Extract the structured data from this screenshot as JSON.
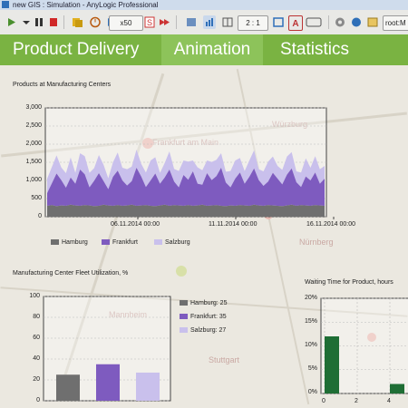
{
  "window": {
    "title": "new GIS : Simulation - AnyLogic Professional"
  },
  "toolbar": {
    "speed_label": "x50",
    "ratio_label": "2 : 1",
    "path_value": "root:M"
  },
  "tabs": [
    {
      "label": "Product Delivery",
      "active": false
    },
    {
      "label": "Animation",
      "active": true
    },
    {
      "label": "Statistics",
      "active": false
    }
  ],
  "map": {
    "places": [
      "Frankfurt am Main",
      "Würzburg",
      "Mannheim",
      "Nürnberg",
      "Stuttgart"
    ]
  },
  "colors": {
    "tab_bar": "#7ab342",
    "tab_active": "#8dc35a",
    "hamburg": "#6f6f6f",
    "frankfurt": "#7e5bbf",
    "salzburg": "#c9c0ec",
    "waiting": "#1f6e35"
  },
  "chart_data": [
    {
      "type": "area",
      "title": "Products at Manufacturing Centers",
      "y_ticks": [
        "3,000",
        "2,500",
        "2,000",
        "1,500",
        "1,000",
        "500",
        "0"
      ],
      "ylim": [
        0,
        3000
      ],
      "x_tick_labels": [
        "06.11.2014 00:00",
        "11.11.2014 00:00",
        "16.11.2014 00:00"
      ],
      "grid": true,
      "legend": "bottom-left",
      "series": [
        {
          "name": "Hamburg",
          "values": [
            300,
            320,
            290,
            310,
            300,
            330,
            310,
            300,
            320,
            310,
            290,
            300,
            330,
            310,
            300,
            320,
            300,
            310,
            330,
            300,
            310,
            320,
            300,
            290,
            310,
            330,
            300,
            320,
            310,
            300,
            320,
            300,
            310,
            330,
            300,
            310,
            320,
            300,
            290,
            310,
            300,
            320,
            310,
            300,
            330,
            310,
            300,
            320,
            310,
            300,
            290,
            310,
            330,
            300,
            320,
            310,
            300,
            320,
            310,
            300
          ]
        },
        {
          "name": "Frankfurt",
          "values": [
            350,
            600,
            900,
            700,
            500,
            750,
            600,
            1000,
            850,
            500,
            700,
            900,
            650,
            450,
            800,
            950,
            700,
            550,
            650,
            1050,
            800,
            500,
            700,
            900,
            600,
            750,
            1000,
            650,
            500,
            850,
            700,
            950,
            600,
            550,
            900,
            700,
            800,
            1050,
            650,
            500,
            750,
            900,
            600,
            800,
            1000,
            700,
            550,
            650,
            900,
            750,
            600,
            850,
            1000,
            650,
            500,
            800,
            700,
            900,
            600,
            750
          ]
        },
        {
          "name": "Salzburg",
          "values": [
            400,
            450,
            500,
            350,
            400,
            550,
            300,
            450,
            500,
            400,
            350,
            500,
            450,
            300,
            400,
            500,
            350,
            450,
            400,
            500,
            350,
            400,
            550,
            450,
            300,
            400,
            500,
            350,
            450,
            400,
            500,
            300,
            450,
            400,
            350,
            500,
            450,
            400,
            300,
            450,
            500,
            400,
            350,
            450,
            500,
            300,
            400,
            550,
            450,
            350,
            400,
            500,
            450,
            300,
            400,
            500,
            350,
            450,
            400,
            350
          ]
        }
      ]
    },
    {
      "type": "bar",
      "title": "Manufacturing Center Fleet Utilization, %",
      "categories": [
        "Hamburg",
        "Frankfurt",
        "Salzburg"
      ],
      "values": [
        25,
        35,
        27
      ],
      "legend_labels": [
        "Hamburg: 25",
        "Frankfurt: 35",
        "Salzburg: 27"
      ],
      "y_ticks": [
        "100",
        "80",
        "60",
        "40",
        "20",
        "0"
      ],
      "ylim": [
        0,
        100
      ],
      "legend": "right"
    },
    {
      "type": "bar",
      "title": "Waiting Time for Product, hours",
      "x": [
        0,
        2
      ],
      "values": [
        12,
        2
      ],
      "y_ticks": [
        "20%",
        "15%",
        "10%",
        "5%",
        "0%"
      ],
      "x_ticks": [
        "0",
        "2",
        "4"
      ],
      "ylim": [
        0,
        20
      ]
    }
  ]
}
